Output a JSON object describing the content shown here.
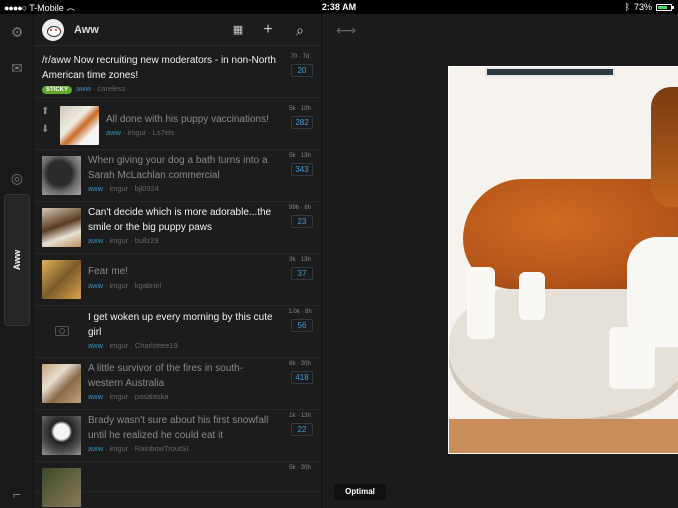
{
  "status": {
    "carrier": "T-Mobile",
    "time": "2:38 AM",
    "battery": "73%",
    "battery_level": 0.73
  },
  "rail": {
    "tab_label": "Aww",
    "icons": [
      "gear-icon",
      "mail-icon",
      "reddit-logo-icon",
      "collapse-icon"
    ]
  },
  "feed": {
    "subreddit": "Aww",
    "posts": [
      {
        "title": "/r/aww Now recruiting new moderators - in non-North American time zones!",
        "sticky": "STICKY",
        "sub": "aww",
        "domain": "",
        "author": "careless",
        "score_meta": "70 · 7d",
        "score": "20",
        "read": false
      },
      {
        "title": "All done with his puppy vaccinations!",
        "sub": "aww",
        "domain": "imgur",
        "author": "Ls7els",
        "score_meta": "5k · 10h",
        "score": "282",
        "read": true
      },
      {
        "title": "When giving your dog a bath turns into a Sarah McLachlan commercial",
        "sub": "aww",
        "domain": "imgur",
        "author": "bjl0924",
        "score_meta": "5k · 13h",
        "score": "343",
        "read": true
      },
      {
        "title": "Can't decide which is more adorable...the smile or the big puppy paws",
        "sub": "aww",
        "domain": "imgur",
        "author": "bullz29",
        "score_meta": "996 · 6h",
        "score": "23",
        "read": false
      },
      {
        "title": "Fear me!",
        "sub": "aww",
        "domain": "imgur",
        "author": "kgabriel",
        "score_meta": "3k · 13h",
        "score": "37",
        "read": true
      },
      {
        "title": "I get woken up every morning by this cute girl",
        "sub": "aww",
        "domain": "imgur",
        "author": "Charlottee19",
        "score_meta": "1.0k · 8h",
        "score": "56",
        "read": false
      },
      {
        "title": "A little survivor of the fires in south-western Australia",
        "sub": "aww",
        "domain": "imgur",
        "author": "pasalaska",
        "score_meta": "6k · 20h",
        "score": "418",
        "read": true
      },
      {
        "title": "Brady wasn't sure about his first snowfall until he realized he could eat it",
        "sub": "aww",
        "domain": "imgur",
        "author": "RainbowTroutSI",
        "score_meta": "1k · 13h",
        "score": "22",
        "read": true
      },
      {
        "title": "",
        "sub": "",
        "domain": "",
        "author": "",
        "score_meta": "5k · 20h",
        "score": "",
        "read": true
      }
    ]
  },
  "detail": {
    "view_mode": "Optimal"
  }
}
